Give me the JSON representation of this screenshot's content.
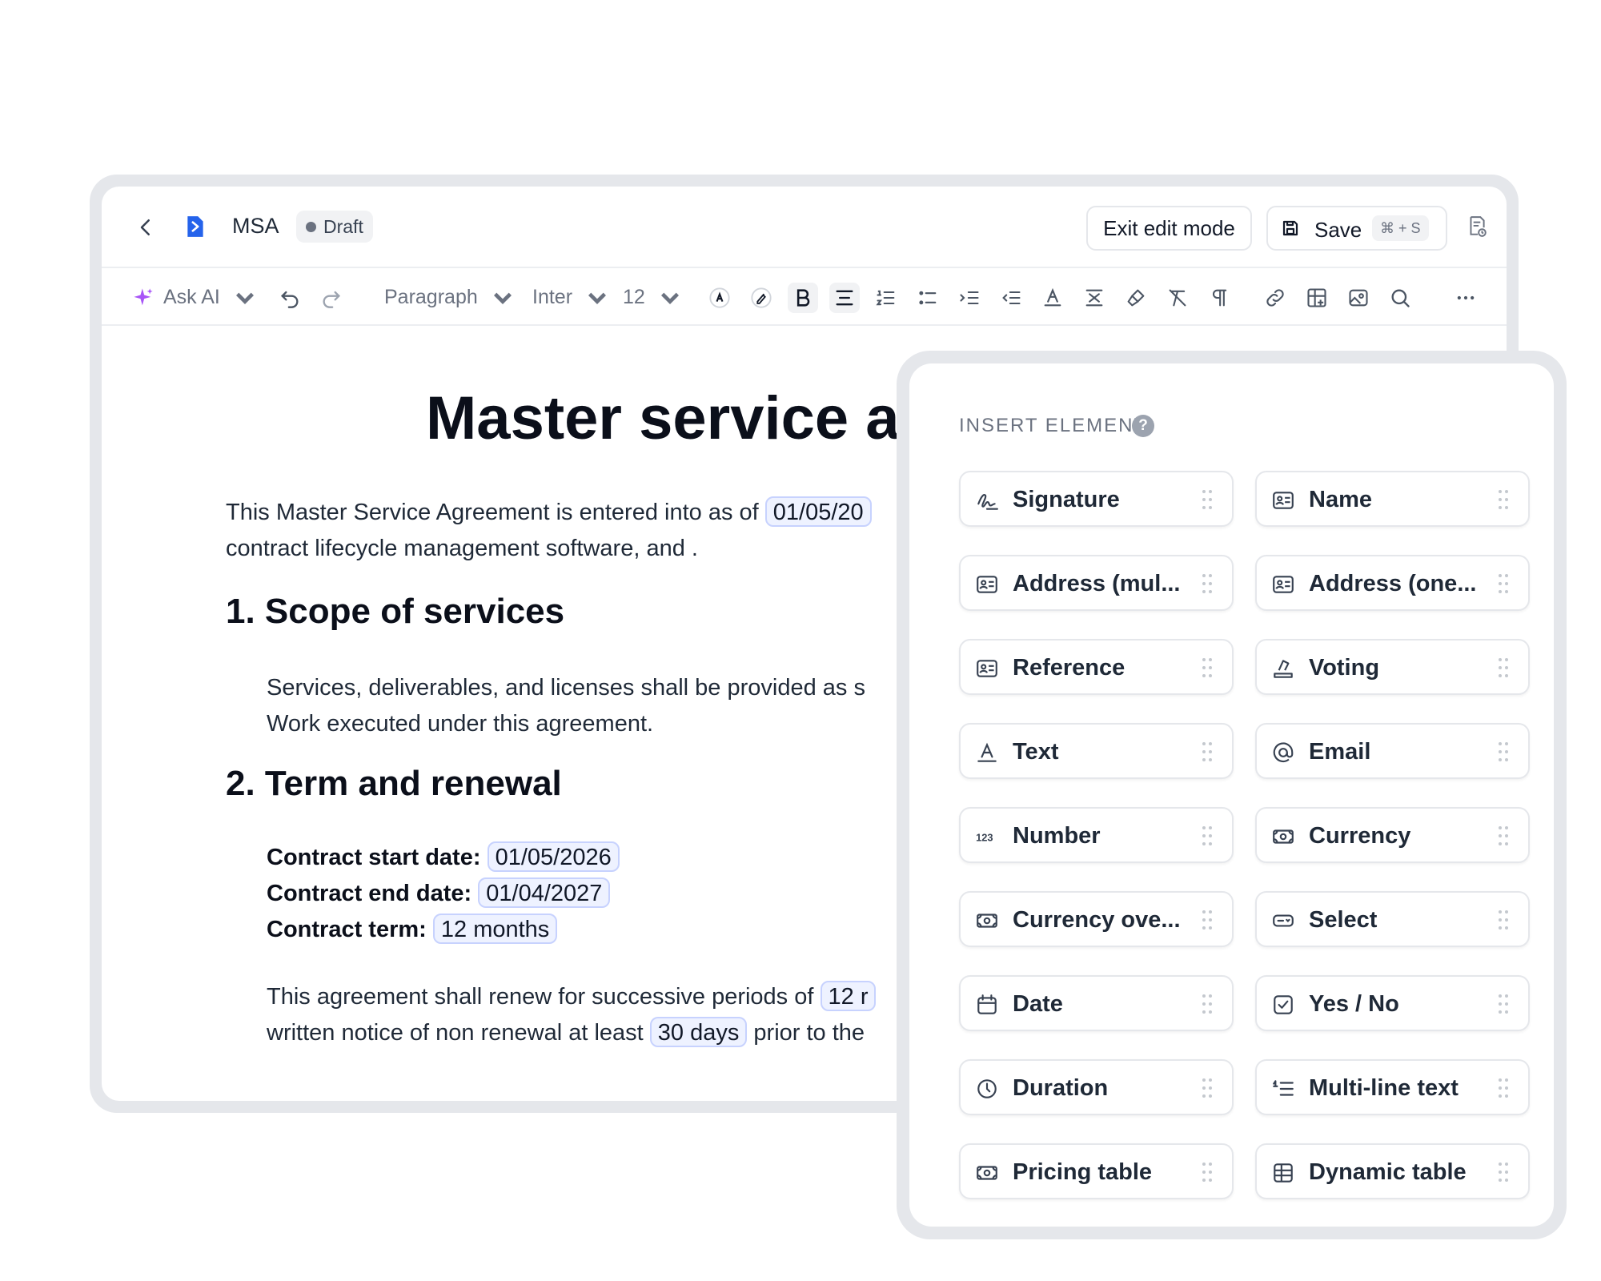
{
  "header": {
    "doc_title": "MSA",
    "status_badge": "Draft",
    "exit_label": "Exit edit mode",
    "save_label": "Save",
    "save_shortcut": "⌘ + S"
  },
  "toolbar": {
    "ask_ai": "Ask AI",
    "paragraph": "Paragraph",
    "font": "Inter",
    "size": "12"
  },
  "document": {
    "title": "Master service a",
    "intro_line1": "This Master Service Agreement is entered into as of",
    "intro_date": "01/05/20",
    "intro_line2": "contract lifecycle management software, and .",
    "section1_heading": "1.  Scope of services",
    "section1_line1": "Services, deliverables, and licenses shall be provided as s",
    "section1_line2": "Work executed under this agreement.",
    "section2_heading": "2. Term and renewal",
    "start_label": "Contract start date:",
    "start_value": "01/05/2026",
    "end_label": "Contract end date:",
    "end_value": "01/04/2027",
    "term_label": "Contract term:",
    "term_value": "12 months",
    "renew_line1": "This agreement shall renew for successive periods of",
    "renew_chip": "12 r",
    "renew_line2_a": "written notice of non renewal at least",
    "renew_days": "30 days",
    "renew_line2_b": "prior to the"
  },
  "panel": {
    "title": "INSERT ELEMENT",
    "help": "?",
    "elements": [
      {
        "label": "Signature",
        "icon": "signature-icon"
      },
      {
        "label": "Name",
        "icon": "id-card-icon"
      },
      {
        "label": "Address (mul...",
        "icon": "id-card-icon"
      },
      {
        "label": "Address (one...",
        "icon": "id-card-icon"
      },
      {
        "label": "Reference",
        "icon": "id-card-icon"
      },
      {
        "label": "Voting",
        "icon": "ballot-icon"
      },
      {
        "label": "Text",
        "icon": "text-icon"
      },
      {
        "label": "Email",
        "icon": "at-sign-icon"
      },
      {
        "label": "Number",
        "icon": "number-icon"
      },
      {
        "label": "Currency",
        "icon": "banknote-icon"
      },
      {
        "label": "Currency ove...",
        "icon": "banknote-icon"
      },
      {
        "label": "Select",
        "icon": "select-icon"
      },
      {
        "label": "Date",
        "icon": "calendar-icon"
      },
      {
        "label": "Yes / No",
        "icon": "checkbox-icon"
      },
      {
        "label": "Duration",
        "icon": "clock-icon"
      },
      {
        "label": "Multi-line text",
        "icon": "list-ordered-icon"
      },
      {
        "label": "Pricing table",
        "icon": "banknote-icon"
      },
      {
        "label": "Dynamic table",
        "icon": "table-icon"
      }
    ]
  },
  "colors": {
    "accent_blue": "#2563eb",
    "ai_purple": "#a855f7",
    "chip_border": "#c7d2fe",
    "chip_bg": "#eef2ff"
  }
}
